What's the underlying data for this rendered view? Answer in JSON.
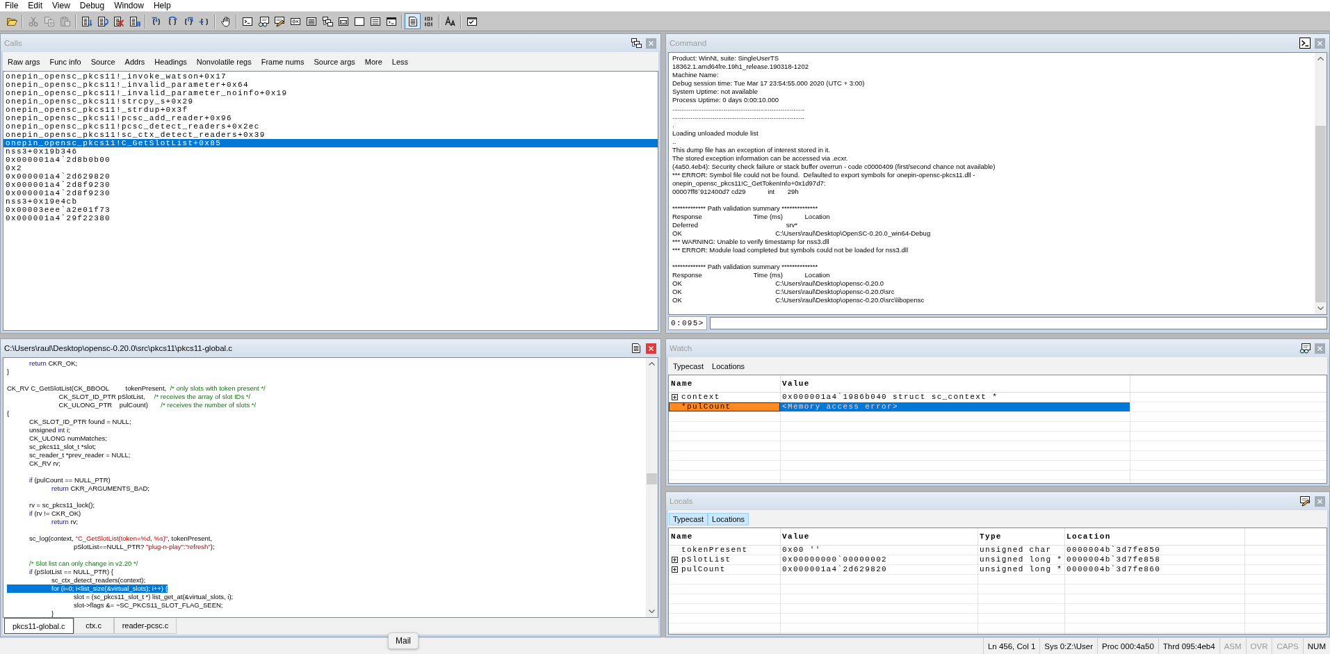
{
  "menu": [
    "File",
    "Edit",
    "View",
    "Debug",
    "Window",
    "Help"
  ],
  "toolbar": [
    {
      "kind": "open",
      "disabled": false,
      "pressed": false
    },
    {
      "kind": "separator"
    },
    {
      "kind": "cut",
      "disabled": true,
      "pressed": false
    },
    {
      "kind": "copy",
      "disabled": true,
      "pressed": false
    },
    {
      "kind": "paste",
      "disabled": true,
      "pressed": false
    },
    {
      "kind": "separator"
    },
    {
      "kind": "go",
      "disabled": false,
      "pressed": false
    },
    {
      "kind": "restart",
      "disabled": false,
      "pressed": false
    },
    {
      "kind": "stop",
      "disabled": false,
      "pressed": false
    },
    {
      "kind": "break",
      "disabled": false,
      "pressed": false
    },
    {
      "kind": "separator"
    },
    {
      "kind": "step-into",
      "disabled": false,
      "pressed": false
    },
    {
      "kind": "step-over",
      "disabled": false,
      "pressed": false
    },
    {
      "kind": "step-out",
      "disabled": false,
      "pressed": false
    },
    {
      "kind": "run-to-cursor",
      "disabled": false,
      "pressed": false
    },
    {
      "kind": "separator"
    },
    {
      "kind": "breakpoint",
      "disabled": false,
      "pressed": false
    },
    {
      "kind": "separator"
    },
    {
      "kind": "command",
      "disabled": false,
      "pressed": false
    },
    {
      "kind": "watch",
      "disabled": false,
      "pressed": false
    },
    {
      "kind": "locals",
      "disabled": false,
      "pressed": false
    },
    {
      "kind": "registers",
      "disabled": false,
      "pressed": false
    },
    {
      "kind": "memory",
      "disabled": false,
      "pressed": false
    },
    {
      "kind": "calls",
      "disabled": false,
      "pressed": false
    },
    {
      "kind": "disassembly",
      "disabled": false,
      "pressed": false
    },
    {
      "kind": "scratch",
      "disabled": false,
      "pressed": false
    },
    {
      "kind": "processes",
      "disabled": false,
      "pressed": false
    },
    {
      "kind": "command-browser",
      "disabled": false,
      "pressed": false
    },
    {
      "kind": "separator"
    },
    {
      "kind": "source-on",
      "disabled": false,
      "pressed": true
    },
    {
      "kind": "source-off",
      "disabled": false,
      "pressed": false
    },
    {
      "kind": "separator"
    },
    {
      "kind": "font",
      "disabled": false,
      "pressed": false
    },
    {
      "kind": "separator"
    },
    {
      "kind": "options",
      "disabled": false,
      "pressed": false
    }
  ],
  "calls": {
    "title": "Calls",
    "active": false,
    "options": [
      "Raw args",
      "Func info",
      "Source",
      "Addrs",
      "Headings",
      "Nonvolatile regs",
      "Frame nums",
      "Source args",
      "More",
      "Less"
    ],
    "frames": [
      {
        "text": "onepin_opensc_pkcs11!_invoke_watson+0x17",
        "selected": false
      },
      {
        "text": "onepin_opensc_pkcs11!_invalid_parameter+0x64",
        "selected": false
      },
      {
        "text": "onepin_opensc_pkcs11!_invalid_parameter_noinfo+0x19",
        "selected": false
      },
      {
        "text": "onepin_opensc_pkcs11!strcpy_s+0x29",
        "selected": false
      },
      {
        "text": "onepin_opensc_pkcs11!_strdup+0x3f",
        "selected": false
      },
      {
        "text": "onepin_opensc_pkcs11!pcsc_add_reader+0x96",
        "selected": false
      },
      {
        "text": "onepin_opensc_pkcs11!pcsc_detect_readers+0x2ec",
        "selected": false
      },
      {
        "text": "onepin_opensc_pkcs11!sc_ctx_detect_readers+0x39",
        "selected": false
      },
      {
        "text": "onepin_opensc_pkcs11!C_GetSlotList+0x85",
        "selected": true
      },
      {
        "text": "nss3+0x19b346",
        "selected": false
      },
      {
        "text": "0x000001a4`2d8b0b00",
        "selected": false
      },
      {
        "text": "0x2",
        "selected": false
      },
      {
        "text": "0x000001a4`2d629820",
        "selected": false
      },
      {
        "text": "0x000001a4`2d8f9230",
        "selected": false
      },
      {
        "text": "0x000001a4`2d8f9230",
        "selected": false
      },
      {
        "text": "nss3+0x19e4cb",
        "selected": false
      },
      {
        "text": "0x00003eee`a2e01f73",
        "selected": false
      },
      {
        "text": "0x000001a4`29f22380",
        "selected": false
      }
    ]
  },
  "command": {
    "title": "Command",
    "active": false,
    "blocks": [
      [
        "Product: WinNt, suite: SingleUserTS",
        "18362.1.amd64fre.19h1_release.190318-1202",
        "Machine Name:",
        "Debug session time: Tue Mar 17 23:54:55.000 2020 (UTC + 3:00)",
        "System Uptime: not available",
        "Process Uptime: 0 days 0:00:10.000",
        "........................................................................",
        "........................................................................",
        ".",
        "Loading unloaded module list",
        "..",
        "This dump file has an exception of interest stored in it.",
        "The stored exception information can be accessed via .ecxr.",
        "(4a50.4eb4): Security check failure or stack buffer overrun - code c0000409 (first/second chance not available)",
        "*** ERROR: Symbol file could not be found.  Defaulted to export symbols for onepin-opensc-pkcs11.dll -",
        "onepin_opensc_pkcs11!C_GetTokenInfo+0x1d97d7:",
        "00007ff8`912400d7 cd29            int       29h"
      ],
      [
        "************* Path validation summary **************",
        "Response                            Time (ms)            Location",
        "Deferred                                                srv*",
        "OK                                                   C:\\Users\\raul\\Desktop\\OpenSC-0.20.0_win64-Debug",
        "*** WARNING: Unable to verify timestamp for nss3.dll",
        "*** ERROR: Module load completed but symbols could not be loaded for nss3.dll"
      ],
      [
        "************* Path validation summary **************",
        "Response                            Time (ms)            Location",
        "OK                                                   C:\\Users\\raul\\Desktop\\opensc-0.20.0",
        "OK                                                   C:\\Users\\raul\\Desktop\\opensc-0.20.0\\src",
        "OK                                                   C:\\Users\\raul\\Desktop\\opensc-0.20.0\\src\\libopensc"
      ]
    ],
    "prompt": "0:095>"
  },
  "source": {
    "title": "C:\\Users\\raul\\Desktop\\opensc-0.20.0\\src\\pkcs11\\pkcs11-global.c",
    "active": true,
    "blocks": [
      [
        {
          "tokens": [
            {
              "kind": "keyword",
              "text": "\treturn"
            },
            {
              "kind": "plain",
              "text": " CKR_OK;"
            }
          ],
          "selected": false
        },
        {
          "tokens": [
            {
              "kind": "plain",
              "text": "}"
            }
          ],
          "selected": false
        }
      ],
      [
        {
          "tokens": [
            {
              "kind": "plain",
              "text": "CK_RV C_GetSlotList(CK_BBOOL         tokenPresent,  "
            },
            {
              "kind": "comment",
              "text": "/* only slots with token present */"
            }
          ],
          "selected": false
        },
        {
          "tokens": [
            {
              "kind": "plain",
              "text": "\t\t    CK_SLOT_ID_PTR pSlotList,     "
            },
            {
              "kind": "comment",
              "text": "/* receives the array of slot IDs */"
            }
          ],
          "selected": false
        },
        {
          "tokens": [
            {
              "kind": "plain",
              "text": "\t\t    CK_ULONG_PTR    pulCount)       "
            },
            {
              "kind": "comment",
              "text": "/* receives the number of slots */"
            }
          ],
          "selected": false
        },
        {
          "tokens": [
            {
              "kind": "plain",
              "text": "{"
            }
          ],
          "selected": false
        },
        {
          "tokens": [
            {
              "kind": "plain",
              "text": "\tCK_SLOT_ID_PTR found = NULL;"
            }
          ],
          "selected": false
        },
        {
          "tokens": [
            {
              "kind": "plain",
              "text": "\tunsigned "
            },
            {
              "kind": "keyword",
              "text": "int"
            },
            {
              "kind": "plain",
              "text": " i;"
            }
          ],
          "selected": false
        },
        {
          "tokens": [
            {
              "kind": "plain",
              "text": "\tCK_ULONG numMatches;"
            }
          ],
          "selected": false
        },
        {
          "tokens": [
            {
              "kind": "plain",
              "text": "\tsc_pkcs11_slot_t *slot;"
            }
          ],
          "selected": false
        },
        {
          "tokens": [
            {
              "kind": "plain",
              "text": "\tsc_reader_t *prev_reader = NULL;"
            }
          ],
          "selected": false
        },
        {
          "tokens": [
            {
              "kind": "plain",
              "text": "\tCK_RV rv;"
            }
          ],
          "selected": false
        }
      ],
      [
        {
          "tokens": [
            {
              "kind": "keyword",
              "text": "\tif"
            },
            {
              "kind": "plain",
              "text": " (pulCount == NULL_PTR)"
            }
          ],
          "selected": false
        },
        {
          "tokens": [
            {
              "kind": "keyword",
              "text": "\t\treturn"
            },
            {
              "kind": "plain",
              "text": " CKR_ARGUMENTS_BAD;"
            }
          ],
          "selected": false
        }
      ],
      [
        {
          "tokens": [
            {
              "kind": "plain",
              "text": "\trv = sc_pkcs11_lock();"
            }
          ],
          "selected": false
        },
        {
          "tokens": [
            {
              "kind": "keyword",
              "text": "\tif"
            },
            {
              "kind": "plain",
              "text": " (rv != CKR_OK)"
            }
          ],
          "selected": false
        },
        {
          "tokens": [
            {
              "kind": "keyword",
              "text": "\t\treturn"
            },
            {
              "kind": "plain",
              "text": " rv;"
            }
          ],
          "selected": false
        }
      ],
      [
        {
          "tokens": [
            {
              "kind": "plain",
              "text": "\tsc_log(context, "
            },
            {
              "kind": "string",
              "text": "\"C_GetSlotList(token=%d, %s)\""
            },
            {
              "kind": "plain",
              "text": ", tokenPresent,"
            }
          ],
          "selected": false
        },
        {
          "tokens": [
            {
              "kind": "plain",
              "text": "\t\t\tpSlotList==NULL_PTR? "
            },
            {
              "kind": "string",
              "text": "\"plug-n-play\""
            },
            {
              "kind": "plain",
              "text": ":"
            },
            {
              "kind": "string",
              "text": "\"refresh\""
            },
            {
              "kind": "plain",
              "text": ");"
            }
          ],
          "selected": false
        }
      ],
      [
        {
          "tokens": [
            {
              "kind": "comment",
              "text": "\t/* Slot list can only change in v2.20 */"
            }
          ],
          "selected": false
        },
        {
          "tokens": [
            {
              "kind": "keyword",
              "text": "\tif"
            },
            {
              "kind": "plain",
              "text": " (pSlotList == NULL_PTR) {"
            }
          ],
          "selected": false
        },
        {
          "tokens": [
            {
              "kind": "plain",
              "text": "\t\tsc_ctx_detect_readers(context);"
            }
          ],
          "selected": false
        },
        {
          "tokens": [
            {
              "kind": "keyword",
              "text": "\t\tfor"
            },
            {
              "kind": "plain",
              "text": " (i=0; i<list_size(&virtual_slots); i++) {"
            }
          ],
          "selected": true
        },
        {
          "tokens": [
            {
              "kind": "plain",
              "text": "\t\t\tslot = (sc_pkcs11_slot_t *) list_get_at(&virtual_slots, i);"
            }
          ],
          "selected": false
        },
        {
          "tokens": [
            {
              "kind": "plain",
              "text": "\t\t\tslot->flags &= ~SC_PKCS11_SLOT_FLAG_SEEN;"
            }
          ],
          "selected": false
        },
        {
          "tokens": [
            {
              "kind": "plain",
              "text": "\t\t}"
            }
          ],
          "selected": false
        }
      ]
    ],
    "tabs": [
      {
        "label": "pkcs11-global.c",
        "selected": true
      },
      {
        "label": "ctx.c",
        "selected": false
      },
      {
        "label": "reader-pcsc.c",
        "selected": false
      }
    ]
  },
  "watch": {
    "title": "Watch",
    "active": false,
    "options": [
      {
        "label": "Typecast",
        "on": false
      },
      {
        "label": "Locations",
        "on": false
      }
    ],
    "columns": [
      "Name",
      "Value"
    ],
    "rows": [
      {
        "name": "context",
        "expandable": true,
        "value": "0x000001a4`1986b040 struct sc_context *",
        "selected": false,
        "error": false
      },
      {
        "name": "*pulCount",
        "expandable": false,
        "value": "<Memory access error>",
        "selected": true,
        "error": true
      }
    ]
  },
  "locals": {
    "title": "Locals",
    "active": false,
    "options": [
      {
        "label": "Typecast",
        "on": true
      },
      {
        "label": "Locations",
        "on": true
      }
    ],
    "columns": [
      "Name",
      "Value",
      "Type",
      "Location"
    ],
    "rows": [
      {
        "name": "tokenPresent",
        "expandable": false,
        "value": "0x00 ''",
        "type": "unsigned char",
        "location": "0000004b`3d7fe850",
        "selected": false,
        "error": false
      },
      {
        "name": "pSlotList",
        "expandable": true,
        "value": "0x00000000`00000002",
        "type": "unsigned long *",
        "location": "0000004b`3d7fe858",
        "selected": false,
        "error": false
      },
      {
        "name": "pulCount",
        "expandable": true,
        "value": "0x000001a4`2d629820",
        "type": "unsigned long *",
        "location": "0000004b`3d7fe860",
        "selected": false,
        "error": false
      }
    ]
  },
  "status_bar": {
    "cells": [
      {
        "text": "Ln 456, Col 1",
        "enabled": true
      },
      {
        "text": "Sys 0:Z:\\User",
        "enabled": true
      },
      {
        "text": "Proc 000:4a50",
        "enabled": true
      },
      {
        "text": "Thrd 095:4eb4",
        "enabled": true
      },
      {
        "text": "ASM",
        "enabled": false
      },
      {
        "text": "OVR",
        "enabled": false
      },
      {
        "text": "CAPS",
        "enabled": false
      },
      {
        "text": "NUM",
        "enabled": true
      }
    ]
  },
  "tooltip": {
    "text": "Mail"
  }
}
